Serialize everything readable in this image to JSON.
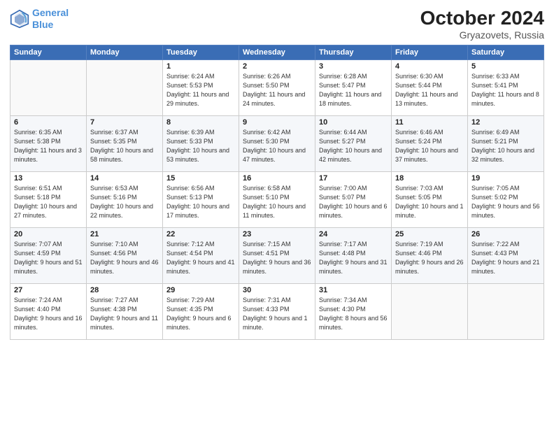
{
  "header": {
    "logo_line1": "General",
    "logo_line2": "Blue",
    "month": "October 2024",
    "location": "Gryazovets, Russia"
  },
  "weekdays": [
    "Sunday",
    "Monday",
    "Tuesday",
    "Wednesday",
    "Thursday",
    "Friday",
    "Saturday"
  ],
  "weeks": [
    [
      {
        "day": "",
        "info": ""
      },
      {
        "day": "",
        "info": ""
      },
      {
        "day": "1",
        "info": "Sunrise: 6:24 AM\nSunset: 5:53 PM\nDaylight: 11 hours and 29 minutes."
      },
      {
        "day": "2",
        "info": "Sunrise: 6:26 AM\nSunset: 5:50 PM\nDaylight: 11 hours and 24 minutes."
      },
      {
        "day": "3",
        "info": "Sunrise: 6:28 AM\nSunset: 5:47 PM\nDaylight: 11 hours and 18 minutes."
      },
      {
        "day": "4",
        "info": "Sunrise: 6:30 AM\nSunset: 5:44 PM\nDaylight: 11 hours and 13 minutes."
      },
      {
        "day": "5",
        "info": "Sunrise: 6:33 AM\nSunset: 5:41 PM\nDaylight: 11 hours and 8 minutes."
      }
    ],
    [
      {
        "day": "6",
        "info": "Sunrise: 6:35 AM\nSunset: 5:38 PM\nDaylight: 11 hours and 3 minutes."
      },
      {
        "day": "7",
        "info": "Sunrise: 6:37 AM\nSunset: 5:35 PM\nDaylight: 10 hours and 58 minutes."
      },
      {
        "day": "8",
        "info": "Sunrise: 6:39 AM\nSunset: 5:33 PM\nDaylight: 10 hours and 53 minutes."
      },
      {
        "day": "9",
        "info": "Sunrise: 6:42 AM\nSunset: 5:30 PM\nDaylight: 10 hours and 47 minutes."
      },
      {
        "day": "10",
        "info": "Sunrise: 6:44 AM\nSunset: 5:27 PM\nDaylight: 10 hours and 42 minutes."
      },
      {
        "day": "11",
        "info": "Sunrise: 6:46 AM\nSunset: 5:24 PM\nDaylight: 10 hours and 37 minutes."
      },
      {
        "day": "12",
        "info": "Sunrise: 6:49 AM\nSunset: 5:21 PM\nDaylight: 10 hours and 32 minutes."
      }
    ],
    [
      {
        "day": "13",
        "info": "Sunrise: 6:51 AM\nSunset: 5:18 PM\nDaylight: 10 hours and 27 minutes."
      },
      {
        "day": "14",
        "info": "Sunrise: 6:53 AM\nSunset: 5:16 PM\nDaylight: 10 hours and 22 minutes."
      },
      {
        "day": "15",
        "info": "Sunrise: 6:56 AM\nSunset: 5:13 PM\nDaylight: 10 hours and 17 minutes."
      },
      {
        "day": "16",
        "info": "Sunrise: 6:58 AM\nSunset: 5:10 PM\nDaylight: 10 hours and 11 minutes."
      },
      {
        "day": "17",
        "info": "Sunrise: 7:00 AM\nSunset: 5:07 PM\nDaylight: 10 hours and 6 minutes."
      },
      {
        "day": "18",
        "info": "Sunrise: 7:03 AM\nSunset: 5:05 PM\nDaylight: 10 hours and 1 minute."
      },
      {
        "day": "19",
        "info": "Sunrise: 7:05 AM\nSunset: 5:02 PM\nDaylight: 9 hours and 56 minutes."
      }
    ],
    [
      {
        "day": "20",
        "info": "Sunrise: 7:07 AM\nSunset: 4:59 PM\nDaylight: 9 hours and 51 minutes."
      },
      {
        "day": "21",
        "info": "Sunrise: 7:10 AM\nSunset: 4:56 PM\nDaylight: 9 hours and 46 minutes."
      },
      {
        "day": "22",
        "info": "Sunrise: 7:12 AM\nSunset: 4:54 PM\nDaylight: 9 hours and 41 minutes."
      },
      {
        "day": "23",
        "info": "Sunrise: 7:15 AM\nSunset: 4:51 PM\nDaylight: 9 hours and 36 minutes."
      },
      {
        "day": "24",
        "info": "Sunrise: 7:17 AM\nSunset: 4:48 PM\nDaylight: 9 hours and 31 minutes."
      },
      {
        "day": "25",
        "info": "Sunrise: 7:19 AM\nSunset: 4:46 PM\nDaylight: 9 hours and 26 minutes."
      },
      {
        "day": "26",
        "info": "Sunrise: 7:22 AM\nSunset: 4:43 PM\nDaylight: 9 hours and 21 minutes."
      }
    ],
    [
      {
        "day": "27",
        "info": "Sunrise: 7:24 AM\nSunset: 4:40 PM\nDaylight: 9 hours and 16 minutes."
      },
      {
        "day": "28",
        "info": "Sunrise: 7:27 AM\nSunset: 4:38 PM\nDaylight: 9 hours and 11 minutes."
      },
      {
        "day": "29",
        "info": "Sunrise: 7:29 AM\nSunset: 4:35 PM\nDaylight: 9 hours and 6 minutes."
      },
      {
        "day": "30",
        "info": "Sunrise: 7:31 AM\nSunset: 4:33 PM\nDaylight: 9 hours and 1 minute."
      },
      {
        "day": "31",
        "info": "Sunrise: 7:34 AM\nSunset: 4:30 PM\nDaylight: 8 hours and 56 minutes."
      },
      {
        "day": "",
        "info": ""
      },
      {
        "day": "",
        "info": ""
      }
    ]
  ]
}
